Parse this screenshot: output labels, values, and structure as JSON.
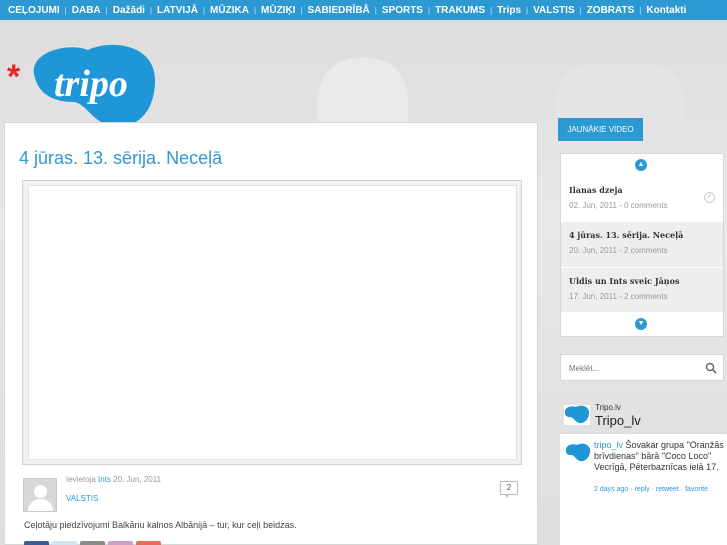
{
  "nav": {
    "items": [
      "CEĻOJUMI",
      "DABA",
      "Dažādi",
      "LATVIJĀ",
      "MŪZIKA",
      "MŪZIĶI",
      "SABIEDRĪBĀ",
      "SPORTS",
      "TRAKUMS",
      "Trips",
      "VALSTIS",
      "ZOBRATS",
      "Kontakti"
    ],
    "separator": "|"
  },
  "logo": {
    "star": "*",
    "text": "tripo"
  },
  "post": {
    "title": "4 jūras. 13. sērija. Neceļā",
    "meta_prefix": "Ievietoja",
    "author": "Ints",
    "date": "20. Jun, 2011",
    "category": "VALSTIS",
    "comment_count": "2",
    "excerpt": "Ceļotāju piedzīvojumi Balkānu kalnos Albānijā – tur, kur ceļi beidzas."
  },
  "sidebar": {
    "latest_title": "JAUNĀKIE VIDEO",
    "videos": [
      {
        "title": "Ilanas dzeja",
        "date": "02. Jun, 2011 - 0 comments"
      },
      {
        "title": "4 jūras. 13. sērija. Neceļā",
        "date": "20. Jun, 2011 - 2 comments"
      },
      {
        "title": "Uldis un Ints sveic Jāņos",
        "date": "17. Jun, 2011 - 2 comments"
      }
    ],
    "search_placeholder": "Meklēt..."
  },
  "twitter": {
    "handle_small": "Tripo.lv",
    "name": "Tripo_lv",
    "tweet_user": "tripo_lv",
    "tweet_text": "Šovakar grupa \"Oranžās brīvdienas\" bārā \"Coco Loco\" Vecrīgā, Pēterbaznīcas ielā 17.",
    "tweet_time": "2 days ago",
    "reply": "reply",
    "retweet": "retweet",
    "favorite": "favorite"
  },
  "colors": {
    "accent": "#2c99d3",
    "logo_red": "#e8262b",
    "logo_blue": "#1f97d6"
  },
  "icons": [
    "arrow-up-icon",
    "arrow-down-icon",
    "check-icon",
    "search-icon",
    "tripo-bird-icon",
    "default-avatar-icon"
  ]
}
